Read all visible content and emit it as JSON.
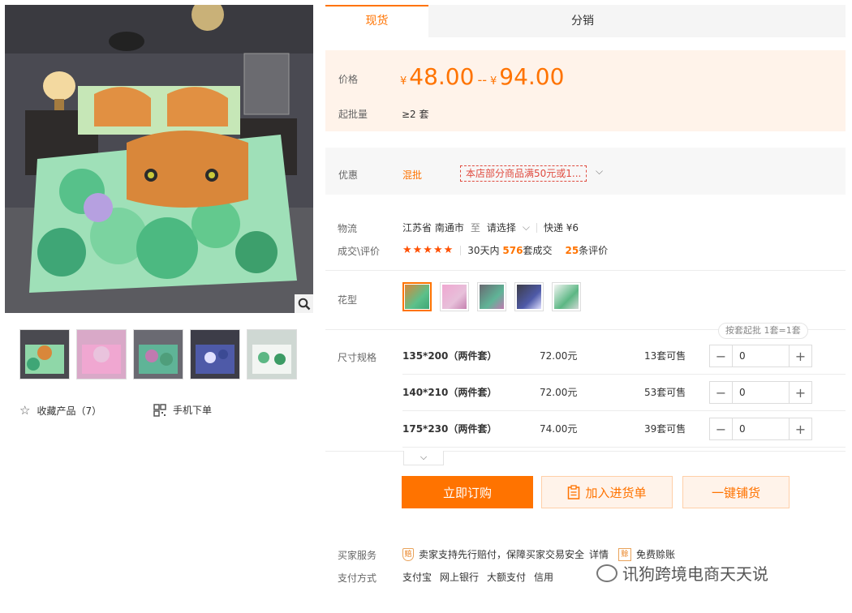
{
  "gallery": {
    "zoom_icon": "magnifier-icon",
    "thumbnail_count": 5,
    "favorite_label": "收藏产品（7）",
    "favorite_icon": "star-outline-icon",
    "mobile_label": "手机下单",
    "mobile_icon": "qr-code-icon"
  },
  "tabs": [
    {
      "label": "现货",
      "active": true
    },
    {
      "label": "分销",
      "active": false
    }
  ],
  "price": {
    "label": "价格",
    "currency": "¥",
    "low": "48.00",
    "separator": "--",
    "high": "94.00",
    "moq_label": "起批量",
    "moq_value": "≥2 套",
    "color": "#ff7300"
  },
  "promo": {
    "label": "优惠",
    "mix_label": "混批",
    "coupon_text": "本店部分商品满50元或1...",
    "coupon_color": "#e04b3f"
  },
  "logistics": {
    "label": "物流",
    "from": "江苏省 南通市",
    "to_word": "至",
    "destination": "请选择",
    "shipping": "快递 ¥6"
  },
  "rating": {
    "label": "成交\\评价",
    "stars": "★★★★★",
    "deals_prefix": "30天内",
    "deals_count": "576",
    "deals_suffix": "套成交",
    "reviews_count": "25",
    "reviews_suffix": "条评价"
  },
  "pattern": {
    "label": "花型",
    "swatch_count": 5,
    "selected_index": 0
  },
  "sizes": {
    "label": "尺寸规格",
    "hint": "按套起批 1套=1套",
    "rows": [
      {
        "name": "135*200（两件套）",
        "price": "72.00元",
        "stock": "13套可售",
        "qty": "0"
      },
      {
        "name": "140*210（两件套）",
        "price": "72.00元",
        "stock": "53套可售",
        "qty": "0"
      },
      {
        "name": "175*230（两件套）",
        "price": "74.00元",
        "stock": "39套可售",
        "qty": "0"
      }
    ],
    "expand_icon": "chevron-down-icon"
  },
  "actions": {
    "buy": "立即订购",
    "cart": "加入进货单",
    "distribute": "一键铺货",
    "cart_icon": "clipboard-icon"
  },
  "services": {
    "buyer_label": "买家服务",
    "guarantee": "卖家支持先行赔付，保障买家交易安全",
    "details": "详情",
    "free_account": "免费赊账",
    "payment_label": "支付方式",
    "payments": [
      "支付宝",
      "网上银行",
      "大额支付",
      "信用"
    ]
  },
  "watermark": "讯狗跨境电商天天说"
}
